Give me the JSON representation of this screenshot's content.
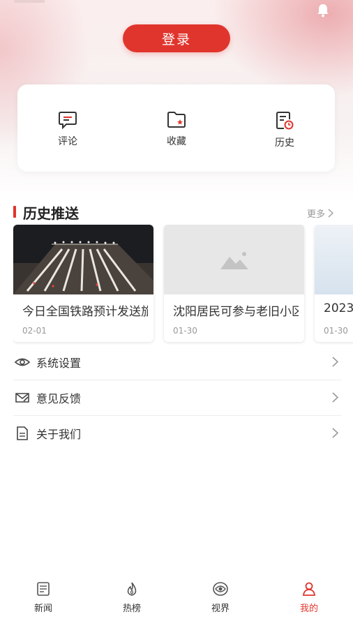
{
  "header": {
    "login_label": "登录",
    "notification_icon": "bell-icon"
  },
  "quick_actions": [
    {
      "label": "评论",
      "icon": "comment-icon"
    },
    {
      "label": "收藏",
      "icon": "favorite-folder-icon"
    },
    {
      "label": "历史",
      "icon": "history-icon"
    }
  ],
  "history_push": {
    "title": "历史推送",
    "more_label": "更多",
    "cards": [
      {
        "title": "今日全国铁路预计发送旅客",
        "date": "02-01",
        "thumb": "railway-night-photo"
      },
      {
        "title": "沈阳居民可参与老旧小区改造",
        "date": "01-30",
        "thumb": "image-placeholder-icon"
      },
      {
        "title": "2023",
        "date": "01-30",
        "thumb": "sky-photo"
      }
    ]
  },
  "menu": [
    {
      "label": "系统设置",
      "icon": "eye-settings-icon"
    },
    {
      "label": "意见反馈",
      "icon": "mail-feedback-icon"
    },
    {
      "label": "关于我们",
      "icon": "document-icon"
    }
  ],
  "tabbar": [
    {
      "label": "新闻",
      "icon": "news-icon",
      "active": false
    },
    {
      "label": "热榜",
      "icon": "flame-icon",
      "active": false
    },
    {
      "label": "视界",
      "icon": "vision-icon",
      "active": false
    },
    {
      "label": "我的",
      "icon": "user-icon",
      "active": true
    }
  ],
  "colors": {
    "accent": "#e0352d",
    "text": "#333333",
    "muted": "#999999"
  }
}
